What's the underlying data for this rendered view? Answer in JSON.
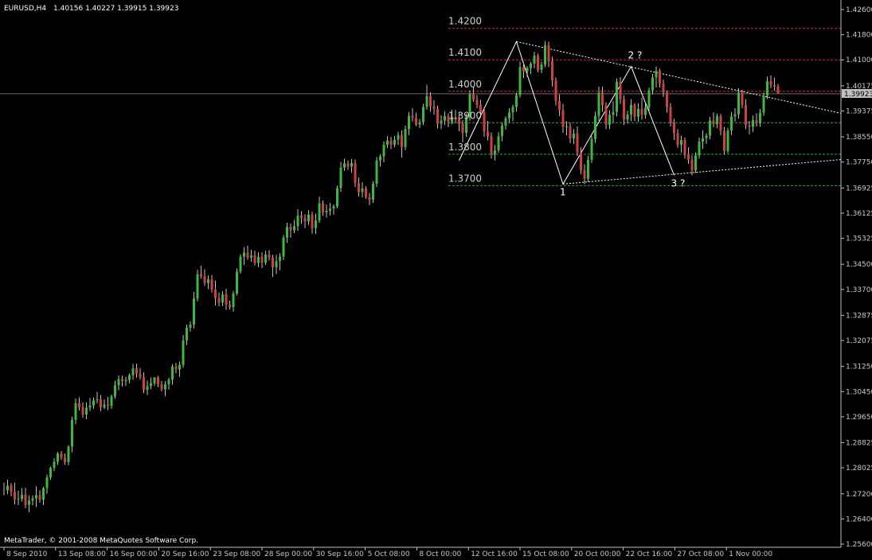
{
  "header": {
    "symbol_text": "EURUSD,H4",
    "ohlc_text": "1.40156 1.40227 1.39915 1.39923"
  },
  "footer": {
    "copyright": "MetaTrader, © 2001-2008 MetaQuotes Software Corp."
  },
  "colors": {
    "background": "#000000",
    "axis": "#c0c0c0",
    "bull_candle": "#3cb83c",
    "bear_candle": "#d04040",
    "wick": "#c0c0c0",
    "resistance_levels": "#cc2e2e",
    "support_levels": "#2aa82a",
    "trend_lines": "#ffffff",
    "price_tag_bg": "#c0c0c0",
    "price_tag_text": "#000000"
  },
  "chart_data": {
    "type": "candlestick",
    "symbol": "EURUSD",
    "timeframe": "H4",
    "ylim": [
      1.256,
      1.426
    ],
    "y_ticks": [
      "1.42600",
      "1.41800",
      "1.41000",
      "1.40175",
      "1.39923",
      "1.39375",
      "1.38550",
      "1.37750",
      "1.36925",
      "1.36125",
      "1.35325",
      "1.34500",
      "1.33700",
      "1.32875",
      "1.32075",
      "1.31250",
      "1.30450",
      "1.29650",
      "1.28825",
      "1.28025",
      "1.27200",
      "1.26400",
      "1.25600"
    ],
    "current_price": "1.39923",
    "x_labels": [
      "8 Sep 2010",
      "13 Sep 08:00",
      "16 Sep 00:00",
      "20 Sep 16:00",
      "23 Sep 08:00",
      "28 Sep 00:00",
      "30 Sep 16:00",
      "5 Oct 08:00",
      "8 Oct 00:00",
      "12 Oct 16:00",
      "15 Oct 08:00",
      "20 Oct 00:00",
      "22 Oct 16:00",
      "27 Oct 08:00",
      "1 Nov 00:00"
    ],
    "levels": [
      {
        "label": "1.4200",
        "price": 1.42,
        "kind": "resistance"
      },
      {
        "label": "1.4100",
        "price": 1.41,
        "kind": "resistance"
      },
      {
        "label": "1.4000",
        "price": 1.4,
        "kind": "resistance"
      },
      {
        "label": "1.3900",
        "price": 1.39,
        "kind": "support"
      },
      {
        "label": "1.3800",
        "price": 1.38,
        "kind": "support"
      },
      {
        "label": "1.3700",
        "price": 1.37,
        "kind": "support"
      }
    ],
    "wave_labels": [
      {
        "text": "1",
        "price": 1.3705
      },
      {
        "text": "2 ?",
        "price": 1.4079
      },
      {
        "text": "3 ?",
        "price": 1.3733
      }
    ],
    "candles": [
      [
        1.2733,
        1.2755,
        1.2715,
        1.2731
      ],
      [
        1.2731,
        1.2765,
        1.2719,
        1.2746
      ],
      [
        1.2746,
        1.2754,
        1.2712,
        1.2726
      ],
      [
        1.2726,
        1.2755,
        1.2686,
        1.2703
      ],
      [
        1.2703,
        1.273,
        1.2684,
        1.2704
      ],
      [
        1.2704,
        1.2738,
        1.2695,
        1.2717
      ],
      [
        1.2717,
        1.2739,
        1.2674,
        1.2685
      ],
      [
        1.2685,
        1.2715,
        1.2661,
        1.2698
      ],
      [
        1.2698,
        1.2715,
        1.2683,
        1.2705
      ],
      [
        1.2705,
        1.2744,
        1.2678,
        1.2716
      ],
      [
        1.2716,
        1.2731,
        1.2692,
        1.2701
      ],
      [
        1.2701,
        1.2742,
        1.2684,
        1.2738
      ],
      [
        1.2738,
        1.2781,
        1.272,
        1.2772
      ],
      [
        1.2772,
        1.2806,
        1.2764,
        1.2802
      ],
      [
        1.2802,
        1.2833,
        1.2792,
        1.2822
      ],
      [
        1.2822,
        1.2853,
        1.2812,
        1.2848
      ],
      [
        1.2848,
        1.2856,
        1.2828,
        1.2835
      ],
      [
        1.2835,
        1.2848,
        1.2812,
        1.2821
      ],
      [
        1.2821,
        1.2875,
        1.2811,
        1.287
      ],
      [
        1.287,
        1.2965,
        1.2852,
        1.2955
      ],
      [
        1.2955,
        1.3023,
        1.2941,
        1.3008
      ],
      [
        1.3008,
        1.3027,
        1.2985,
        1.2995
      ],
      [
        1.2995,
        1.3011,
        1.2962,
        1.2972
      ],
      [
        1.2972,
        1.3011,
        1.2957,
        1.2994
      ],
      [
        1.2994,
        1.3025,
        1.2983,
        1.3001
      ],
      [
        1.3001,
        1.3026,
        1.299,
        1.3017
      ],
      [
        1.3017,
        1.3044,
        1.3007,
        1.302
      ],
      [
        1.302,
        1.3034,
        1.2983,
        1.2994
      ],
      [
        1.2994,
        1.302,
        1.2989,
        1.3004
      ],
      [
        1.3004,
        1.3028,
        1.2986,
        1.3
      ],
      [
        1.3,
        1.3036,
        1.299,
        1.303
      ],
      [
        1.303,
        1.308,
        1.3022,
        1.3065
      ],
      [
        1.3065,
        1.3097,
        1.3049,
        1.3085
      ],
      [
        1.3085,
        1.3096,
        1.3061,
        1.3078
      ],
      [
        1.3078,
        1.3092,
        1.3063,
        1.3082
      ],
      [
        1.3082,
        1.3103,
        1.3071,
        1.3097
      ],
      [
        1.3097,
        1.3133,
        1.3083,
        1.3119
      ],
      [
        1.3119,
        1.3134,
        1.3089,
        1.3102
      ],
      [
        1.3102,
        1.312,
        1.3083,
        1.3091
      ],
      [
        1.3091,
        1.3106,
        1.304,
        1.305
      ],
      [
        1.305,
        1.308,
        1.3034,
        1.3063
      ],
      [
        1.3063,
        1.309,
        1.3053,
        1.3071
      ],
      [
        1.3071,
        1.3091,
        1.3063,
        1.309
      ],
      [
        1.309,
        1.3095,
        1.3059,
        1.3068
      ],
      [
        1.3068,
        1.3079,
        1.3046,
        1.3052
      ],
      [
        1.3052,
        1.3078,
        1.303,
        1.3068
      ],
      [
        1.3068,
        1.3089,
        1.3051,
        1.3083
      ],
      [
        1.3083,
        1.3132,
        1.3067,
        1.3125
      ],
      [
        1.3125,
        1.3136,
        1.3103,
        1.3115
      ],
      [
        1.3115,
        1.314,
        1.3092,
        1.313
      ],
      [
        1.313,
        1.3225,
        1.3121,
        1.3208
      ],
      [
        1.3208,
        1.3258,
        1.3193,
        1.3248
      ],
      [
        1.3248,
        1.3268,
        1.3236,
        1.3258
      ],
      [
        1.3258,
        1.3362,
        1.3246,
        1.3341
      ],
      [
        1.3341,
        1.3432,
        1.3332,
        1.3418
      ],
      [
        1.3418,
        1.3445,
        1.3404,
        1.3412
      ],
      [
        1.3412,
        1.3434,
        1.3381,
        1.339
      ],
      [
        1.339,
        1.3414,
        1.3371,
        1.3402
      ],
      [
        1.3402,
        1.3416,
        1.336,
        1.3369
      ],
      [
        1.3369,
        1.3398,
        1.3318,
        1.3342
      ],
      [
        1.3342,
        1.336,
        1.3316,
        1.3328
      ],
      [
        1.3328,
        1.3364,
        1.3317,
        1.3354
      ],
      [
        1.3354,
        1.3372,
        1.3305,
        1.3321
      ],
      [
        1.3321,
        1.3334,
        1.3306,
        1.3314
      ],
      [
        1.3314,
        1.3365,
        1.3299,
        1.3357
      ],
      [
        1.3357,
        1.3437,
        1.3351,
        1.3427
      ],
      [
        1.3427,
        1.3482,
        1.342,
        1.3474
      ],
      [
        1.3474,
        1.3504,
        1.3448,
        1.3487
      ],
      [
        1.3487,
        1.3509,
        1.3464,
        1.3471
      ],
      [
        1.3471,
        1.3496,
        1.3458,
        1.3478
      ],
      [
        1.3478,
        1.3493,
        1.3446,
        1.3454
      ],
      [
        1.3454,
        1.3488,
        1.3441,
        1.3474
      ],
      [
        1.3474,
        1.3488,
        1.3438,
        1.3455
      ],
      [
        1.3455,
        1.3493,
        1.3448,
        1.3481
      ],
      [
        1.3481,
        1.3495,
        1.3462,
        1.3471
      ],
      [
        1.3471,
        1.348,
        1.341,
        1.344
      ],
      [
        1.344,
        1.348,
        1.3419,
        1.346
      ],
      [
        1.346,
        1.3485,
        1.3431,
        1.3474
      ],
      [
        1.3474,
        1.3543,
        1.3463,
        1.3535
      ],
      [
        1.3535,
        1.3582,
        1.3518,
        1.3569
      ],
      [
        1.3569,
        1.358,
        1.3534,
        1.3558
      ],
      [
        1.3558,
        1.3591,
        1.3549,
        1.3571
      ],
      [
        1.3571,
        1.3625,
        1.3556,
        1.3605
      ],
      [
        1.3605,
        1.3619,
        1.3579,
        1.3597
      ],
      [
        1.3597,
        1.3609,
        1.3565,
        1.3586
      ],
      [
        1.3586,
        1.3622,
        1.3575,
        1.3608
      ],
      [
        1.3608,
        1.3617,
        1.3547,
        1.3565
      ],
      [
        1.3565,
        1.3611,
        1.3546,
        1.3589
      ],
      [
        1.3589,
        1.3665,
        1.3581,
        1.3644
      ],
      [
        1.3644,
        1.3653,
        1.3604,
        1.3615
      ],
      [
        1.3615,
        1.364,
        1.3598,
        1.362
      ],
      [
        1.362,
        1.3645,
        1.3605,
        1.3627
      ],
      [
        1.3627,
        1.364,
        1.3608,
        1.3634
      ],
      [
        1.3634,
        1.37,
        1.3628,
        1.3692
      ],
      [
        1.3692,
        1.3775,
        1.368,
        1.3757
      ],
      [
        1.3757,
        1.3786,
        1.3747,
        1.3771
      ],
      [
        1.3771,
        1.378,
        1.375,
        1.376
      ],
      [
        1.376,
        1.3785,
        1.3741,
        1.3772
      ],
      [
        1.3772,
        1.3783,
        1.3695,
        1.3708
      ],
      [
        1.3708,
        1.3726,
        1.3665,
        1.3679
      ],
      [
        1.3679,
        1.3711,
        1.3662,
        1.3691
      ],
      [
        1.3691,
        1.3698,
        1.3658,
        1.3664
      ],
      [
        1.3664,
        1.3677,
        1.3638,
        1.3655
      ],
      [
        1.3655,
        1.3714,
        1.3645,
        1.3706
      ],
      [
        1.3706,
        1.3791,
        1.3696,
        1.378
      ],
      [
        1.378,
        1.38,
        1.3761,
        1.3793
      ],
      [
        1.3793,
        1.384,
        1.3774,
        1.383
      ],
      [
        1.383,
        1.3857,
        1.382,
        1.3843
      ],
      [
        1.3843,
        1.3855,
        1.3816,
        1.383
      ],
      [
        1.383,
        1.3858,
        1.3822,
        1.3846
      ],
      [
        1.3846,
        1.3871,
        1.3829,
        1.3861
      ],
      [
        1.3861,
        1.3876,
        1.3789,
        1.3823
      ],
      [
        1.3823,
        1.3891,
        1.3813,
        1.388
      ],
      [
        1.388,
        1.3934,
        1.3861,
        1.3922
      ],
      [
        1.3922,
        1.3947,
        1.3904,
        1.3915
      ],
      [
        1.3915,
        1.3932,
        1.3889,
        1.3894
      ],
      [
        1.3894,
        1.3912,
        1.3883,
        1.3902
      ],
      [
        1.3902,
        1.396,
        1.3893,
        1.395
      ],
      [
        1.395,
        1.4021,
        1.3942,
        1.3985
      ],
      [
        1.3985,
        1.3997,
        1.3935,
        1.3952
      ],
      [
        1.3952,
        1.3972,
        1.3925,
        1.3944
      ],
      [
        1.3944,
        1.3955,
        1.3882,
        1.3897
      ],
      [
        1.3897,
        1.3924,
        1.388,
        1.3907
      ],
      [
        1.3907,
        1.3936,
        1.3893,
        1.3921
      ],
      [
        1.3921,
        1.393,
        1.3886,
        1.3903
      ],
      [
        1.3903,
        1.3942,
        1.3895,
        1.3918
      ],
      [
        1.3918,
        1.3941,
        1.3899,
        1.3911
      ],
      [
        1.3911,
        1.3932,
        1.3873,
        1.3897
      ],
      [
        1.3897,
        1.3908,
        1.3838,
        1.3868
      ],
      [
        1.3868,
        1.3929,
        1.3855,
        1.3918
      ],
      [
        1.3918,
        1.4003,
        1.3906,
        1.3992
      ],
      [
        1.3992,
        1.4015,
        1.3967,
        1.3973
      ],
      [
        1.3973,
        1.3988,
        1.3946,
        1.3957
      ],
      [
        1.3957,
        1.3973,
        1.3925,
        1.3934
      ],
      [
        1.3934,
        1.3949,
        1.3855,
        1.3872
      ],
      [
        1.3872,
        1.3906,
        1.3844,
        1.3858
      ],
      [
        1.3858,
        1.3869,
        1.3786,
        1.3801
      ],
      [
        1.3801,
        1.3829,
        1.378,
        1.3812
      ],
      [
        1.3812,
        1.387,
        1.3805,
        1.3857
      ],
      [
        1.3857,
        1.39,
        1.3841,
        1.3891
      ],
      [
        1.3891,
        1.392,
        1.3878,
        1.3914
      ],
      [
        1.3914,
        1.3946,
        1.39,
        1.3933
      ],
      [
        1.3933,
        1.3957,
        1.3905,
        1.395
      ],
      [
        1.395,
        1.3996,
        1.3935,
        1.3988
      ],
      [
        1.3988,
        1.4094,
        1.398,
        1.4077
      ],
      [
        1.4077,
        1.4093,
        1.4042,
        1.4063
      ],
      [
        1.4063,
        1.408,
        1.4046,
        1.4074
      ],
      [
        1.4074,
        1.4094,
        1.4055,
        1.4088
      ],
      [
        1.4088,
        1.4126,
        1.4073,
        1.4114
      ],
      [
        1.4114,
        1.412,
        1.406,
        1.4068
      ],
      [
        1.4068,
        1.4095,
        1.4058,
        1.4085
      ],
      [
        1.4085,
        1.416,
        1.4077,
        1.4146
      ],
      [
        1.4146,
        1.4158,
        1.4077,
        1.4095
      ],
      [
        1.4095,
        1.411,
        1.4015,
        1.4035
      ],
      [
        1.4035,
        1.4044,
        1.3955,
        1.397
      ],
      [
        1.397,
        1.399,
        1.3921,
        1.3941
      ],
      [
        1.3941,
        1.396,
        1.3868,
        1.3887
      ],
      [
        1.3887,
        1.3905,
        1.386,
        1.3888
      ],
      [
        1.3888,
        1.39,
        1.3835,
        1.385
      ],
      [
        1.385,
        1.388,
        1.3832,
        1.3866
      ],
      [
        1.3866,
        1.3888,
        1.3794,
        1.3806
      ],
      [
        1.3806,
        1.3822,
        1.3736,
        1.3749
      ],
      [
        1.3749,
        1.3768,
        1.3705,
        1.3722
      ],
      [
        1.3722,
        1.3795,
        1.3712,
        1.3782
      ],
      [
        1.3782,
        1.3858,
        1.3772,
        1.3848
      ],
      [
        1.3848,
        1.3935,
        1.3836,
        1.3922
      ],
      [
        1.3922,
        1.4015,
        1.3906,
        1.3996
      ],
      [
        1.3996,
        1.4015,
        1.3935,
        1.3955
      ],
      [
        1.3955,
        1.3965,
        1.388,
        1.3894
      ],
      [
        1.3894,
        1.394,
        1.388,
        1.3925
      ],
      [
        1.3925,
        1.3968,
        1.39,
        1.3934
      ],
      [
        1.3934,
        1.4041,
        1.392,
        1.403
      ],
      [
        1.403,
        1.4045,
        1.396,
        1.3975
      ],
      [
        1.3975,
        1.3987,
        1.3893,
        1.391
      ],
      [
        1.391,
        1.3938,
        1.3897,
        1.3926
      ],
      [
        1.3926,
        1.3975,
        1.3905,
        1.3957
      ],
      [
        1.3957,
        1.3962,
        1.3905,
        1.3919
      ],
      [
        1.3919,
        1.3962,
        1.3903,
        1.3944
      ],
      [
        1.3944,
        1.398,
        1.391,
        1.3925
      ],
      [
        1.3925,
        1.3962,
        1.3913,
        1.3948
      ],
      [
        1.3948,
        1.4012,
        1.3935,
        1.4003
      ],
      [
        1.4003,
        1.4055,
        1.399,
        1.4044
      ],
      [
        1.4044,
        1.4079,
        1.4012,
        1.4065
      ],
      [
        1.4065,
        1.4072,
        1.4012,
        1.4025
      ],
      [
        1.4025,
        1.4037,
        1.3982,
        1.3996
      ],
      [
        1.3996,
        1.4003,
        1.3932,
        1.395
      ],
      [
        1.395,
        1.3962,
        1.3888,
        1.3899
      ],
      [
        1.3899,
        1.3912,
        1.3845,
        1.3867
      ],
      [
        1.3867,
        1.388,
        1.382,
        1.383
      ],
      [
        1.383,
        1.3859,
        1.3805,
        1.3845
      ],
      [
        1.3845,
        1.3853,
        1.3786,
        1.3801
      ],
      [
        1.3801,
        1.3822,
        1.3769,
        1.3782
      ],
      [
        1.3782,
        1.3796,
        1.3733,
        1.3748
      ],
      [
        1.3748,
        1.3806,
        1.374,
        1.3796
      ],
      [
        1.3796,
        1.3853,
        1.3786,
        1.384
      ],
      [
        1.384,
        1.3876,
        1.3817,
        1.3851
      ],
      [
        1.3851,
        1.3867,
        1.3833,
        1.3859
      ],
      [
        1.3859,
        1.3919,
        1.3847,
        1.3907
      ],
      [
        1.3907,
        1.3933,
        1.3885,
        1.3895
      ],
      [
        1.3895,
        1.3929,
        1.3883,
        1.3921
      ],
      [
        1.3921,
        1.3928,
        1.386,
        1.3874
      ],
      [
        1.3874,
        1.3887,
        1.38,
        1.381
      ],
      [
        1.381,
        1.3884,
        1.3803,
        1.3875
      ],
      [
        1.3875,
        1.3934,
        1.3861,
        1.392
      ],
      [
        1.392,
        1.3946,
        1.3904,
        1.3927
      ],
      [
        1.3927,
        1.401,
        1.3913,
        1.3996
      ],
      [
        1.3996,
        1.4005,
        1.3946,
        1.3957
      ],
      [
        1.3957,
        1.3975,
        1.388,
        1.3892
      ],
      [
        1.3892,
        1.3906,
        1.3863,
        1.3887
      ],
      [
        1.3887,
        1.3923,
        1.3871,
        1.3908
      ],
      [
        1.3908,
        1.393,
        1.3888,
        1.3898
      ],
      [
        1.3898,
        1.3944,
        1.3887,
        1.3932
      ],
      [
        1.3932,
        1.3996,
        1.3922,
        1.3986
      ],
      [
        1.3986,
        1.4047,
        1.3975,
        1.4032
      ],
      [
        1.4032,
        1.405,
        1.401,
        1.402
      ],
      [
        1.402,
        1.4044,
        1.4002,
        1.4016
      ],
      [
        1.4016,
        1.4023,
        1.3992,
        1.3992
      ]
    ]
  }
}
